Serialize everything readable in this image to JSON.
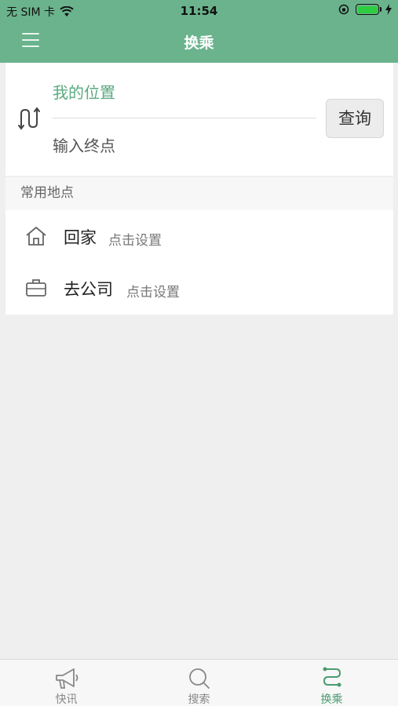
{
  "status_bar": {
    "carrier": "无 SIM 卡",
    "time": "11:54",
    "wifi_icon": "wifi-icon",
    "battery_color": "#2ecc40"
  },
  "header": {
    "title": "换乘",
    "menu_icon": "hamburger-menu-icon",
    "color": "#6ab38d"
  },
  "route": {
    "origin": "我的位置",
    "destination_placeholder": "输入终点",
    "query_label": "查询",
    "swap_icon": "swap-route-icon"
  },
  "places": {
    "header": "常用地点",
    "items": [
      {
        "name": "回家",
        "hint": "点击设置",
        "icon": "home-icon"
      },
      {
        "name": "去公司",
        "hint": "点击设置",
        "icon": "briefcase-icon"
      }
    ]
  },
  "tabs": [
    {
      "label": "快讯",
      "icon": "megaphone-icon",
      "active": false
    },
    {
      "label": "搜索",
      "icon": "search-icon",
      "active": false
    },
    {
      "label": "换乘",
      "icon": "transfer-route-icon",
      "active": true
    }
  ],
  "accent_color": "#4a9b70"
}
